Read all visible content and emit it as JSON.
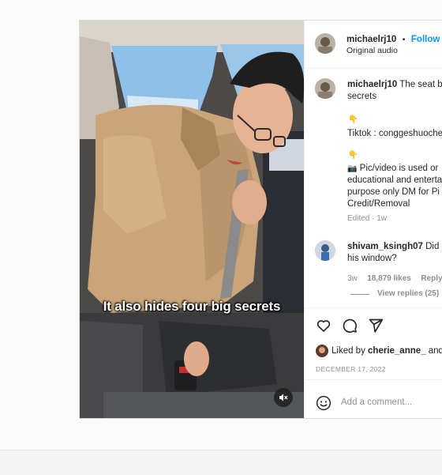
{
  "header": {
    "username": "michaelrj10",
    "follow_label": "Follow",
    "separator": "•",
    "audio": "Original audio"
  },
  "caption": {
    "username": "michaelrj10",
    "line1": "The seat be",
    "line2": "secrets",
    "emoji1": "👇",
    "tiktok": "Tiktok : conggeshuoche",
    "emoji2": "👇",
    "emoji3": "📷",
    "line3": "Pic/video is used or",
    "line4": "educational and enterta",
    "line5": "purpose only DM for Pi",
    "line6": "Credit/Removal",
    "meta": "Edited · 1w"
  },
  "comment": {
    "username": "shivam_ksingh07",
    "line1": "Did h",
    "line2": "his window?",
    "time": "3w",
    "likes": "18,879 likes",
    "reply": "Reply",
    "view_replies": "View replies (25)"
  },
  "likes": {
    "prefix": "Liked by ",
    "user": "cherie_anne_",
    "suffix": " and"
  },
  "date": "DECEMBER 17, 2022",
  "comment_box": {
    "placeholder": "Add a comment..."
  },
  "video": {
    "overlay_text": "It also hides four big secrets"
  },
  "colors": {
    "accent": "#0095f6"
  },
  "icons": [
    "heart-icon",
    "comment-icon",
    "share-icon",
    "smiley-icon",
    "mute-icon"
  ]
}
